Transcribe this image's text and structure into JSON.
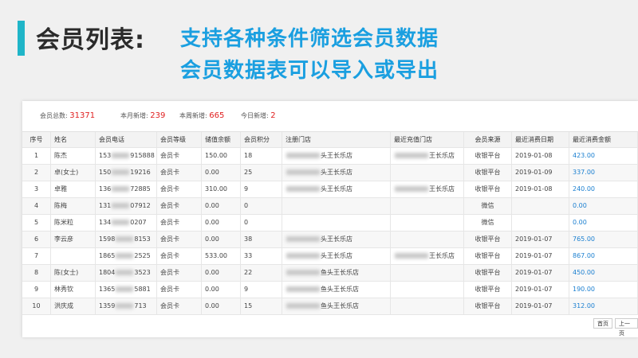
{
  "slide": {
    "title": "会员列表:",
    "subtitle_line1": "支持各种条件筛选会员数据",
    "subtitle_line2": "会员数据表可以导入或导出",
    "accent_color": "#1fb5c8",
    "subtitle_color": "#1a9fe0"
  },
  "stats": {
    "total_label": "会员总数:",
    "total_value": "31371",
    "month_label": "本月新增:",
    "month_value": "239",
    "week_label": "本周新增:",
    "week_value": "665",
    "today_label": "今日新增:",
    "today_value": "2"
  },
  "table": {
    "headers": [
      "序号",
      "姓名",
      "会员电话",
      "会员等级",
      "储值余额",
      "会员积分",
      "注册门店",
      "最近充值门店",
      "会员来源",
      "最近消费日期",
      "最近消费金额"
    ],
    "rows": [
      {
        "no": "1",
        "name": "陈杰",
        "phone_a": "153",
        "phone_b": "915888",
        "level": "会员卡",
        "balance": "150.00",
        "points": "18",
        "reg_store": "头王长乐店",
        "recharge_store": "王长乐店",
        "source": "收银平台",
        "date": "2019-01-08",
        "amount": "423.00"
      },
      {
        "no": "2",
        "name": "卓(女士)",
        "phone_a": "150",
        "phone_b": "19216",
        "level": "会员卡",
        "balance": "0.00",
        "points": "25",
        "reg_store": "头王长乐店",
        "recharge_store": "",
        "source": "收银平台",
        "date": "2019-01-09",
        "amount": "337.00"
      },
      {
        "no": "3",
        "name": "卓雅",
        "phone_a": "136",
        "phone_b": "72885",
        "level": "会员卡",
        "balance": "310.00",
        "points": "9",
        "reg_store": "头王长乐店",
        "recharge_store": "王长乐店",
        "source": "收银平台",
        "date": "2019-01-08",
        "amount": "240.00"
      },
      {
        "no": "4",
        "name": "陈梅",
        "phone_a": "131",
        "phone_b": "07912",
        "level": "会员卡",
        "balance": "0.00",
        "points": "0",
        "reg_store": "",
        "recharge_store": "",
        "source": "微信",
        "date": "",
        "amount": "0.00"
      },
      {
        "no": "5",
        "name": "陈米粒",
        "phone_a": "134",
        "phone_b": "0207",
        "level": "会员卡",
        "balance": "0.00",
        "points": "0",
        "reg_store": "",
        "recharge_store": "",
        "source": "微信",
        "date": "",
        "amount": "0.00"
      },
      {
        "no": "6",
        "name": "李云彦",
        "phone_a": "1598",
        "phone_b": "8153",
        "level": "会员卡",
        "balance": "0.00",
        "points": "38",
        "reg_store": "头王长乐店",
        "recharge_store": "",
        "source": "收银平台",
        "date": "2019-01-07",
        "amount": "765.00"
      },
      {
        "no": "7",
        "name": "",
        "phone_a": "1865",
        "phone_b": "2525",
        "level": "会员卡",
        "balance": "533.00",
        "points": "33",
        "reg_store": "头王长乐店",
        "recharge_store": "王长乐店",
        "source": "收银平台",
        "date": "2019-01-07",
        "amount": "867.00"
      },
      {
        "no": "8",
        "name": "陈(女士)",
        "phone_a": "1804",
        "phone_b": "3523",
        "level": "会员卡",
        "balance": "0.00",
        "points": "22",
        "reg_store": "鱼头王长乐店",
        "recharge_store": "",
        "source": "收银平台",
        "date": "2019-01-07",
        "amount": "450.00"
      },
      {
        "no": "9",
        "name": "林秀钦",
        "phone_a": "1365",
        "phone_b": "5881",
        "level": "会员卡",
        "balance": "0.00",
        "points": "9",
        "reg_store": "鱼头王长乐店",
        "recharge_store": "",
        "source": "收银平台",
        "date": "2019-01-07",
        "amount": "190.00"
      },
      {
        "no": "10",
        "name": "洪庆成",
        "phone_a": "1359",
        "phone_b": "713",
        "level": "会员卡",
        "balance": "0.00",
        "points": "15",
        "reg_store": "鱼头王长乐店",
        "recharge_store": "",
        "source": "收银平台",
        "date": "2019-01-07",
        "amount": "312.00"
      }
    ]
  },
  "pager": {
    "first": "首页",
    "prev": "上一页"
  }
}
